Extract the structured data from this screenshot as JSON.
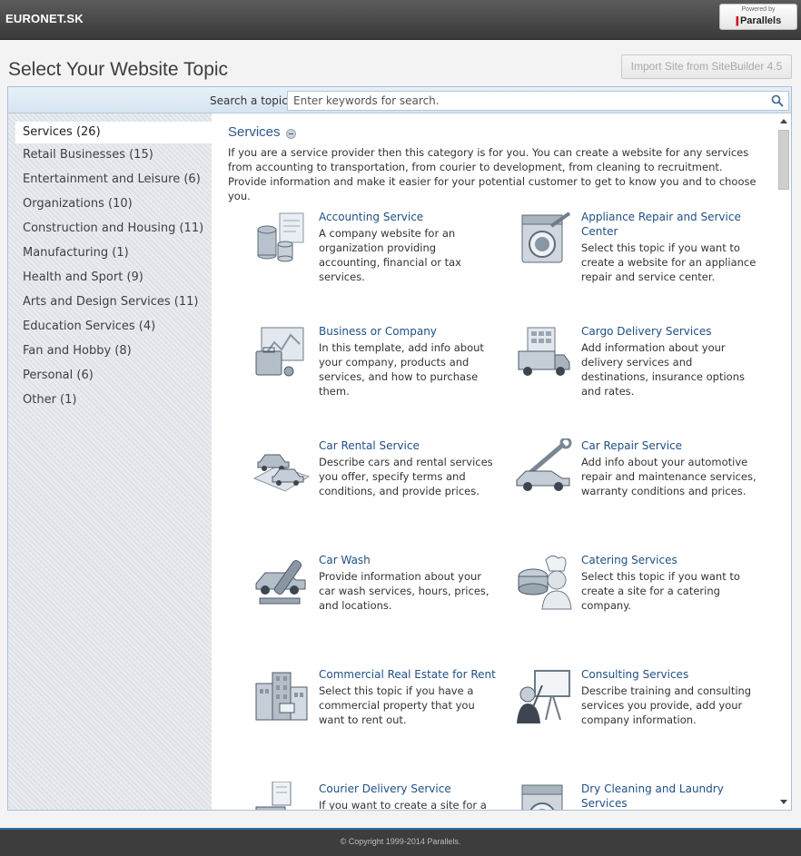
{
  "header": {
    "brand": "EURONET.SK",
    "powered_by": "Powered by",
    "vendor": "Parallels"
  },
  "page": {
    "title": "Select Your Website Topic",
    "import_button": "Import Site from SiteBuilder 4.5"
  },
  "search": {
    "label": "Search a topic",
    "placeholder": "Enter keywords for search."
  },
  "sidebar": {
    "items": [
      {
        "label": "Services (26)",
        "active": true
      },
      {
        "label": "Retail Businesses (15)"
      },
      {
        "label": "Entertainment and Leisure (6)"
      },
      {
        "label": "Organizations (10)"
      },
      {
        "label": "Construction and Housing (11)"
      },
      {
        "label": "Manufacturing (1)"
      },
      {
        "label": "Health and Sport (9)"
      },
      {
        "label": "Arts and Design Services (11)"
      },
      {
        "label": "Education Services (4)"
      },
      {
        "label": "Fan and Hobby (8)"
      },
      {
        "label": "Personal (6)"
      },
      {
        "label": "Other (1)"
      }
    ]
  },
  "category": {
    "title": "Services",
    "description": "If you are a service provider then this category is for you. You can create a website for any services from accounting to transportation, from courier to development, from cleaning to recruitment. Provide information and make it easier for your potential customer to get to know you and to choose you."
  },
  "topics": [
    {
      "name": "Accounting Service",
      "desc": "A company website for an organization providing accounting, financial or tax services.",
      "icon": "coins-icon"
    },
    {
      "name": "Appliance Repair and Service Center",
      "desc": "Select this topic if you want to create a website for an appliance repair and service center.",
      "icon": "washing-machine-icon"
    },
    {
      "name": "Business or Company",
      "desc": "In this template, add info about your company, products and services, and how to purchase them.",
      "icon": "briefcase-icon"
    },
    {
      "name": "Cargo Delivery Services",
      "desc": "Add information about your delivery services and destinations, insurance options and rates.",
      "icon": "truck-icon"
    },
    {
      "name": "Car Rental Service",
      "desc": "Describe cars and rental services you offer, specify terms and conditions, and provide prices.",
      "icon": "cars-icon"
    },
    {
      "name": "Car Repair Service",
      "desc": "Add info about your automotive repair and maintenance services, warranty conditions and prices.",
      "icon": "wrench-car-icon"
    },
    {
      "name": "Car Wash",
      "desc": "Provide information about your car wash services, hours, prices, and locations.",
      "icon": "car-wash-icon"
    },
    {
      "name": "Catering Services",
      "desc": "Select this topic if you want to create a site for a catering company.",
      "icon": "chef-icon"
    },
    {
      "name": "Commercial Real Estate for Rent",
      "desc": "Select this topic if you have a commercial property that you want to rent out.",
      "icon": "buildings-icon"
    },
    {
      "name": "Consulting Services",
      "desc": "Describe training and consulting services you provide, add your company information.",
      "icon": "presenter-icon"
    },
    {
      "name": "Courier Delivery Service",
      "desc": "If you want to create a site for a",
      "icon": "courier-icon"
    },
    {
      "name": "Dry Cleaning and Laundry Services",
      "desc": "",
      "icon": "laundry-icon"
    }
  ],
  "footer": {
    "copyright": "© Copyright 1999-2014 Parallels."
  }
}
